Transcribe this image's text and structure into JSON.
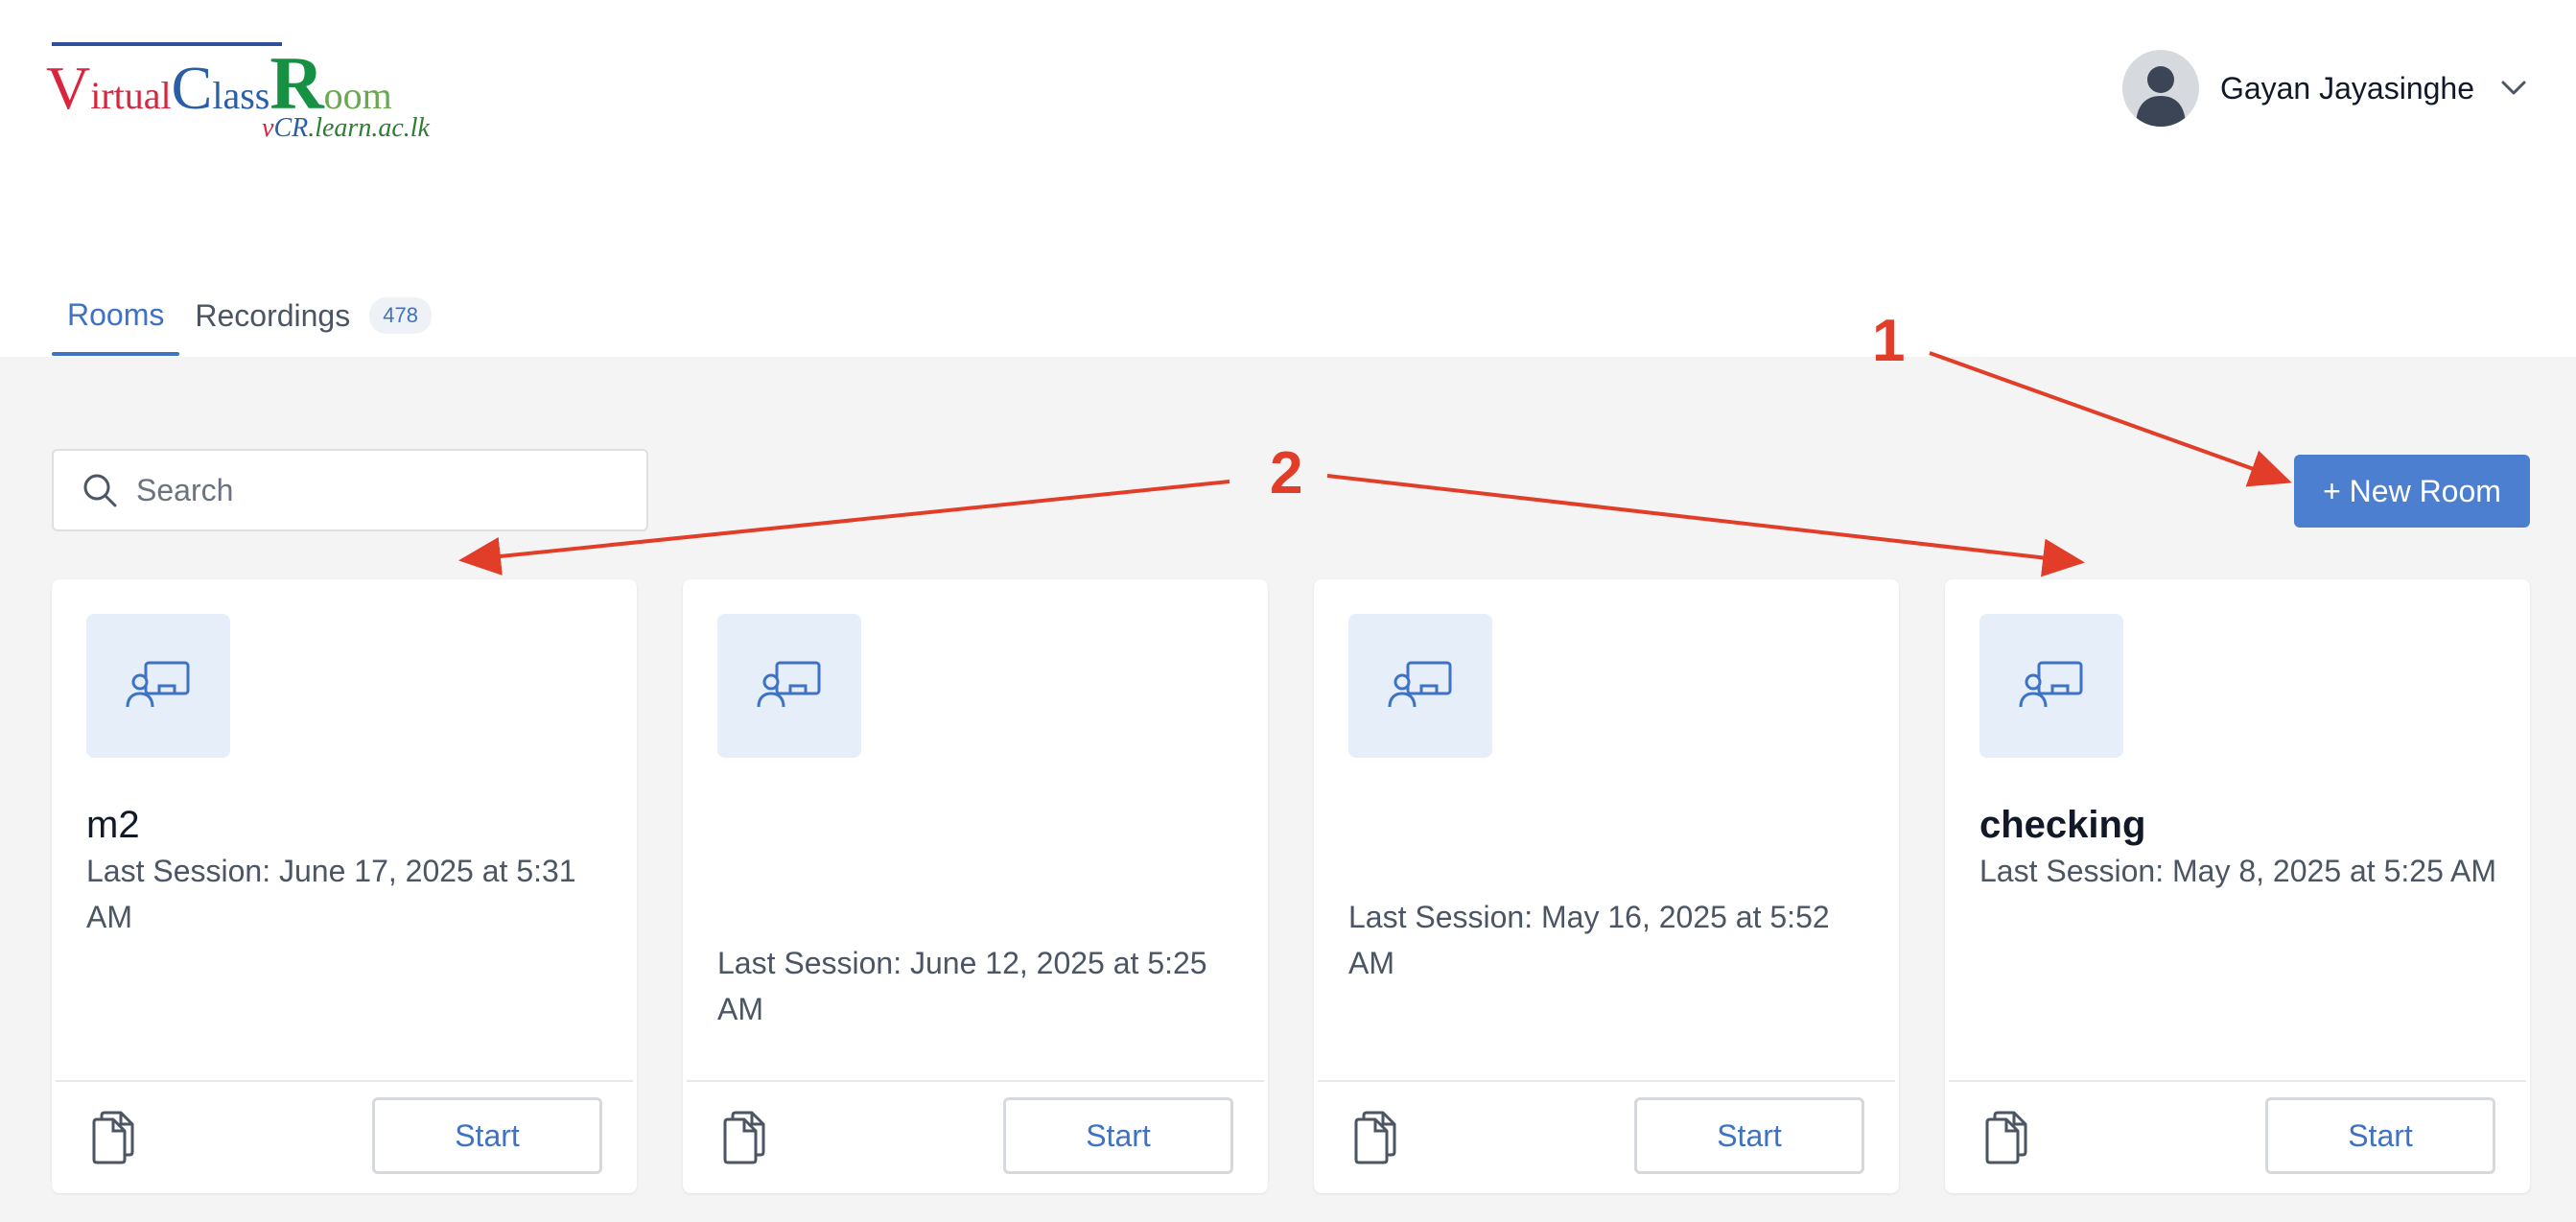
{
  "logo": {
    "v": "V",
    "irtual": "irtual",
    "c": "C",
    "lass": "lass",
    "r": "R",
    "oom": "oom",
    "sub_v": "v",
    "sub_cr": "CR",
    "sub_rest": ".learn.ac.lk"
  },
  "user": {
    "name": "Gayan Jayasinghe"
  },
  "tabs": {
    "rooms": "Rooms",
    "recordings": "Recordings",
    "recordings_count": "478"
  },
  "search": {
    "placeholder": "Search"
  },
  "toolbar": {
    "new_room_label": "+ New Room"
  },
  "rooms": [
    {
      "name": "m2",
      "last_session": "Last Session: June 17, 2025 at 5:31 AM",
      "start_label": "Start"
    },
    {
      "name": "",
      "last_session": "Last Session: June 12, 2025 at 5:25 AM",
      "start_label": "Start"
    },
    {
      "name": "",
      "last_session": "Last Session: May 16, 2025 at 5:52 AM",
      "start_label": "Start"
    },
    {
      "name": "checking",
      "last_session": "Last Session: May 8, 2025 at 5:25 AM",
      "start_label": "Start"
    }
  ],
  "annotations": {
    "label_1": "1",
    "label_2": "2"
  },
  "colors": {
    "accent": "#4d7fd1",
    "annotation": "#e23d28",
    "background": "#f4f4f4"
  }
}
